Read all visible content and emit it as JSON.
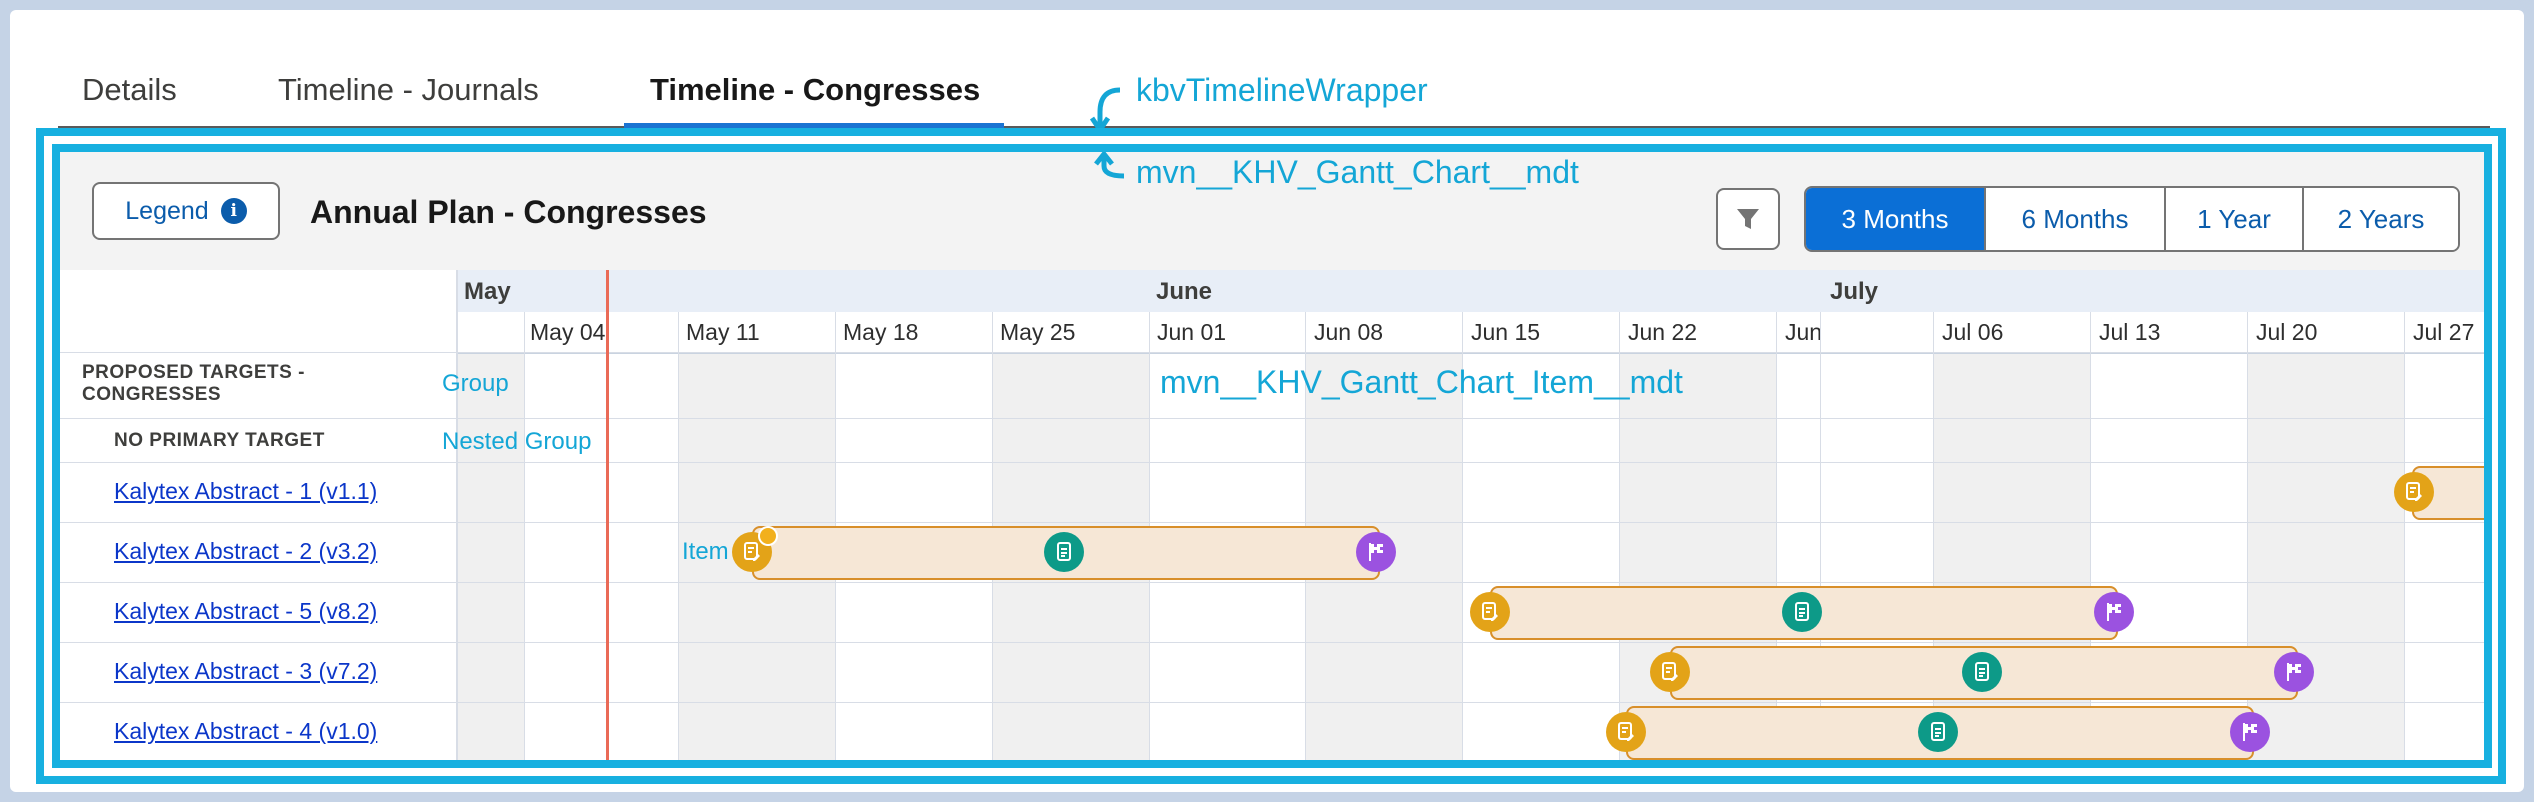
{
  "tabs": [
    {
      "label": "Details",
      "active": false
    },
    {
      "label": "Timeline - Journals",
      "active": false
    },
    {
      "label": "Timeline - Congresses",
      "active": true
    }
  ],
  "annotations": {
    "wrapper": "kbvTimelineWrapper",
    "gantt_chart": "mvn__KHV_Gantt_Chart__mdt",
    "gantt_item": "mvn__KHV_Gantt_Chart_Item__mdt",
    "group": "Group",
    "nested_group": "Nested Group",
    "item": "Item"
  },
  "toolbar": {
    "legend_label": "Legend",
    "title": "Annual Plan - Congresses",
    "ranges": [
      {
        "label": "3 Months",
        "active": true
      },
      {
        "label": "6 Months",
        "active": false
      },
      {
        "label": "1 Year",
        "active": false
      },
      {
        "label": "2 Years",
        "active": false
      }
    ]
  },
  "timeline": {
    "months": [
      "May",
      "June",
      "July"
    ],
    "weeks": [
      "May 04",
      "May 11",
      "May 18",
      "May 25",
      "Jun 01",
      "Jun 08",
      "Jun 15",
      "Jun 22",
      "Jun",
      "Jul 06",
      "Jul 13",
      "Jul 20",
      "Jul 27"
    ]
  },
  "rows": {
    "group": "PROPOSED TARGETS - CONGRESSES",
    "nested_group": "NO PRIMARY TARGET",
    "items": [
      "Kalytex Abstract - 1 (v1.1)",
      "Kalytex Abstract - 2 (v3.2)",
      "Kalytex Abstract - 5 (v8.2)",
      "Kalytex Abstract - 3 (v7.2)",
      "Kalytex Abstract - 4 (v1.0)"
    ]
  },
  "colors": {
    "accent": "#0b6fd6",
    "annotation": "#17b0e0",
    "today": "#ea6a57",
    "milestone_start": "#e3a318",
    "milestone_mid": "#0d9a88",
    "milestone_end": "#9b52e0"
  },
  "icons": {
    "legend": "info-icon",
    "filter": "filter-icon",
    "start": "document-edit-icon",
    "mid": "document-icon",
    "end": "flag-icon"
  }
}
